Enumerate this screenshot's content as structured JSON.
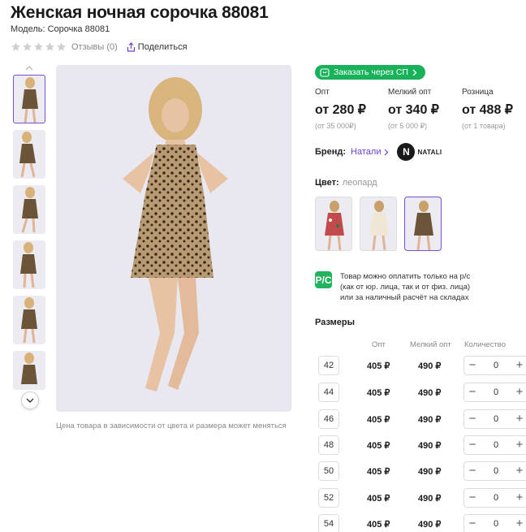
{
  "product": {
    "title": "Женская ночная сорочка 88081",
    "model": "Модель: Сорочка 88081",
    "reviews": "Отзывы (0)",
    "share": "Поделиться",
    "photo_caption": "Цена товара в зависимости от цвета и размера может меняться",
    "rating": 0
  },
  "sp_button": "Заказать через СП",
  "prices": [
    {
      "label": "Опт",
      "value": "от 280 ₽",
      "note": "(от 35 000₽)"
    },
    {
      "label": "Мелкий опт",
      "value": "от 340 ₽",
      "note": "(от 5 000 ₽)"
    },
    {
      "label": "Розница",
      "value": "от 488 ₽",
      "note": "(от 1 товара)"
    }
  ],
  "brand": {
    "label": "Бренд:",
    "name": "Натали",
    "logo_text": "NATALI"
  },
  "color": {
    "label": "Цвет:",
    "value": "леопард"
  },
  "payment_note": {
    "icon_text": "P/C",
    "lines": [
      "Товар можно оплатить только на р/с",
      "(как от юр. лица, так и от физ. лица)",
      "или за наличный расчёт на складах"
    ]
  },
  "sizes": {
    "title": "Размеры",
    "headers": {
      "opt": "Опт",
      "small_opt": "Мелкий опт",
      "quantity": "Количество"
    },
    "rows": [
      {
        "size": "42",
        "opt": "405 ₽",
        "small_opt": "490 ₽",
        "qty": "0"
      },
      {
        "size": "44",
        "opt": "405 ₽",
        "small_opt": "490 ₽",
        "qty": "0"
      },
      {
        "size": "46",
        "opt": "405 ₽",
        "small_opt": "490 ₽",
        "qty": "0"
      },
      {
        "size": "48",
        "opt": "405 ₽",
        "small_opt": "490 ₽",
        "qty": "0"
      },
      {
        "size": "50",
        "opt": "405 ₽",
        "small_opt": "490 ₽",
        "qty": "0"
      },
      {
        "size": "52",
        "opt": "405 ₽",
        "small_opt": "490 ₽",
        "qty": "0"
      },
      {
        "size": "54",
        "opt": "405 ₽",
        "small_opt": "490 ₽",
        "qty": "0"
      }
    ]
  },
  "colors": {
    "accent": "#7a4fd8",
    "green": "#18b25a",
    "text": "#1a1a1a",
    "muted": "#8a8a8a"
  }
}
